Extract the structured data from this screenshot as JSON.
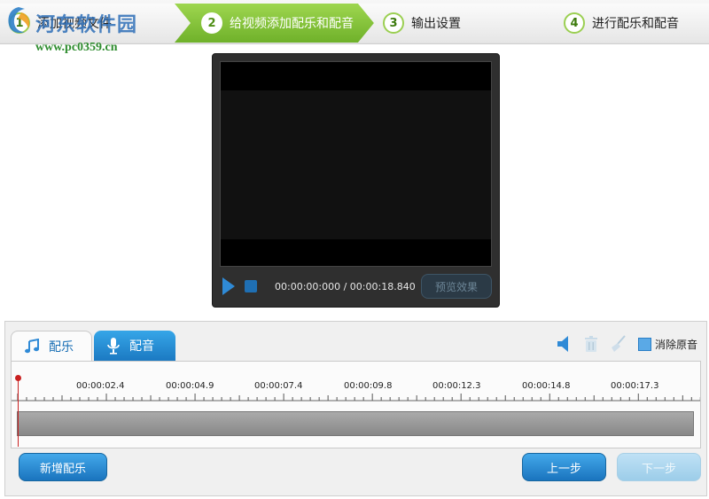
{
  "steps": [
    {
      "num": "1",
      "label": "添加视频文件",
      "active": false
    },
    {
      "num": "2",
      "label": "给视频添加配乐和配音",
      "active": true
    },
    {
      "num": "3",
      "label": "输出设置",
      "active": false
    },
    {
      "num": "4",
      "label": "进行配乐和配音",
      "active": false
    }
  ],
  "watermark": {
    "title": "河东软件园",
    "url": "www.pc0359.cn"
  },
  "player": {
    "timecode": "00:00:00:000 / 00:00:18.840",
    "preview_label": "预览效果"
  },
  "tabs": [
    {
      "label": "配乐",
      "icon": "music-note-icon",
      "active": true
    },
    {
      "label": "配音",
      "icon": "microphone-icon",
      "active": false
    }
  ],
  "tools": {
    "mute_original_label": "消除原音"
  },
  "timeline": {
    "ticks": [
      "00:00:02.4",
      "00:00:04.9",
      "00:00:07.4",
      "00:00:09.8",
      "00:00:12.3",
      "00:00:14.8",
      "00:00:17.3"
    ]
  },
  "buttons": {
    "add_music": "新增配乐",
    "prev": "上一步",
    "next": "下一步"
  },
  "colors": {
    "accent_green": "#7cbf34",
    "accent_blue": "#1f7fc8",
    "playhead": "#c92020"
  }
}
